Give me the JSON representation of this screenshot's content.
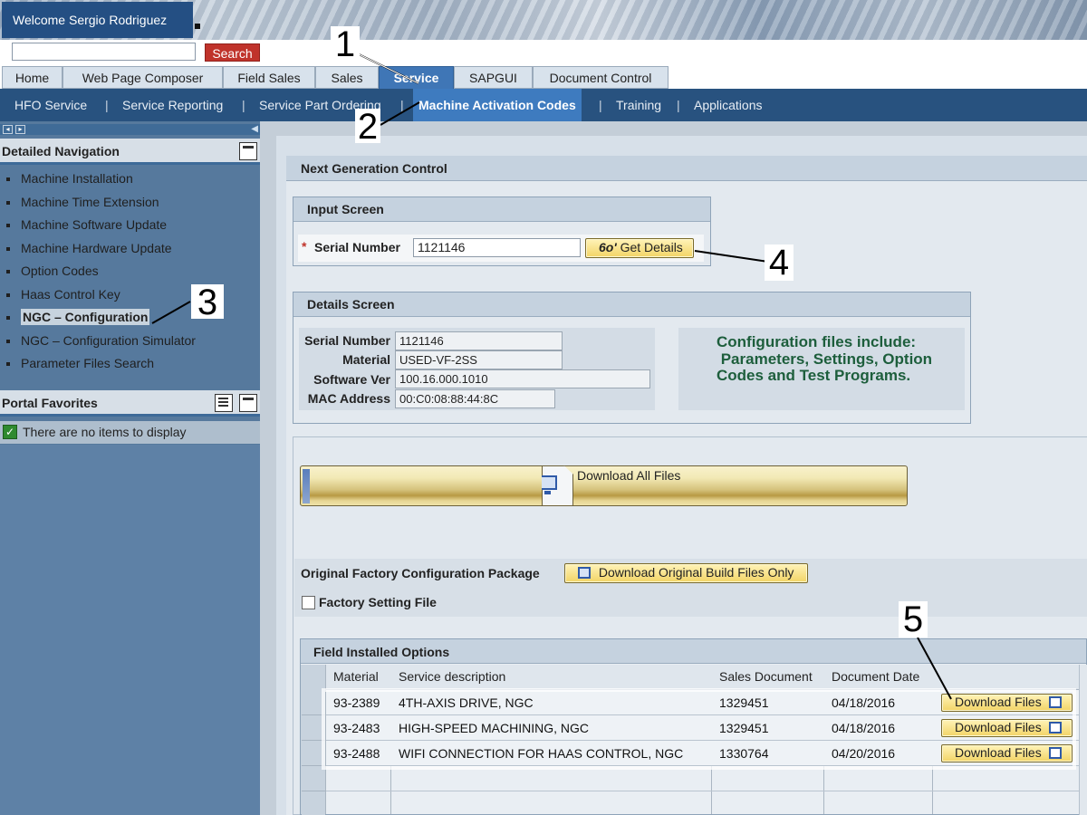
{
  "header": {
    "welcome": "Welcome Sergio Rodriguez",
    "search_button": "Search",
    "search_value": ""
  },
  "tabs": [
    "Home",
    "Web Page Composer",
    "Field Sales",
    "Sales",
    "Service",
    "SAPGUI",
    "Document Control"
  ],
  "active_tab": "Service",
  "subnav": [
    "HFO Service",
    "Service Reporting",
    "Service Part Ordering",
    "Machine Activation Codes",
    "Training",
    "Applications"
  ],
  "active_subnav": "Machine Activation Codes",
  "left_panel": {
    "detailed_nav_title": "Detailed Navigation",
    "items": [
      "Machine Installation",
      "Machine Time Extension",
      "Machine Software Update",
      "Machine Hardware Update",
      "Option Codes",
      "Haas Control Key",
      "NGC – Configuration",
      "NGC – Configuration Simulator",
      "Parameter Files Search"
    ],
    "active_item": "NGC – Configuration",
    "favorites_title": "Portal Favorites",
    "favorites_empty": "There are no items to display"
  },
  "main": {
    "section_title": "Next Generation Control",
    "input_screen": {
      "title": "Input Screen",
      "required_mark": "*",
      "serial_label": "Serial Number",
      "serial_value": "1121146",
      "get_details_button": "Get Details"
    },
    "details_screen": {
      "title": "Details Screen",
      "serial_label": "Serial Number",
      "serial_value": "1121146",
      "material_label": "Material",
      "material_value": "USED-VF-2SS",
      "software_label": "Software Ver",
      "software_value": "100.16.000.1010",
      "mac_label": "MAC Address",
      "mac_value": "00:C0:08:88:44:8C",
      "info_line1": "Configuration files include:",
      "info_line2": " Parameters, Settings, Option",
      "info_line3": "Codes and Test Programs."
    },
    "download_all": "Download All Files",
    "original_package_label": "Original Factory Configuration Package",
    "download_original_button": "Download Original Build Files Only",
    "factory_setting_label": "Factory Setting File",
    "field_options": {
      "title": "Field Installed Options",
      "columns": [
        "Material",
        "Service description",
        "Sales Document",
        "Document Date"
      ],
      "rows": [
        {
          "material": "93-2389",
          "description": "4TH-AXIS DRIVE, NGC",
          "sales_doc": "1329451",
          "date": "04/18/2016",
          "button": "Download Files"
        },
        {
          "material": "93-2483",
          "description": "HIGH-SPEED MACHINING, NGC",
          "sales_doc": "1329451",
          "date": "04/18/2016",
          "button": "Download Files"
        },
        {
          "material": "93-2488",
          "description": "WIFI CONNECTION FOR HAAS CONTROL, NGC",
          "sales_doc": "1330764",
          "date": "04/20/2016",
          "button": "Download Files"
        }
      ]
    }
  },
  "callouts": [
    "1",
    "2",
    "3",
    "4",
    "5"
  ],
  "icons": {
    "get_details": "binoculars-icon",
    "download": "download-computer-icon",
    "favorites_ok": "checkmark-icon"
  }
}
